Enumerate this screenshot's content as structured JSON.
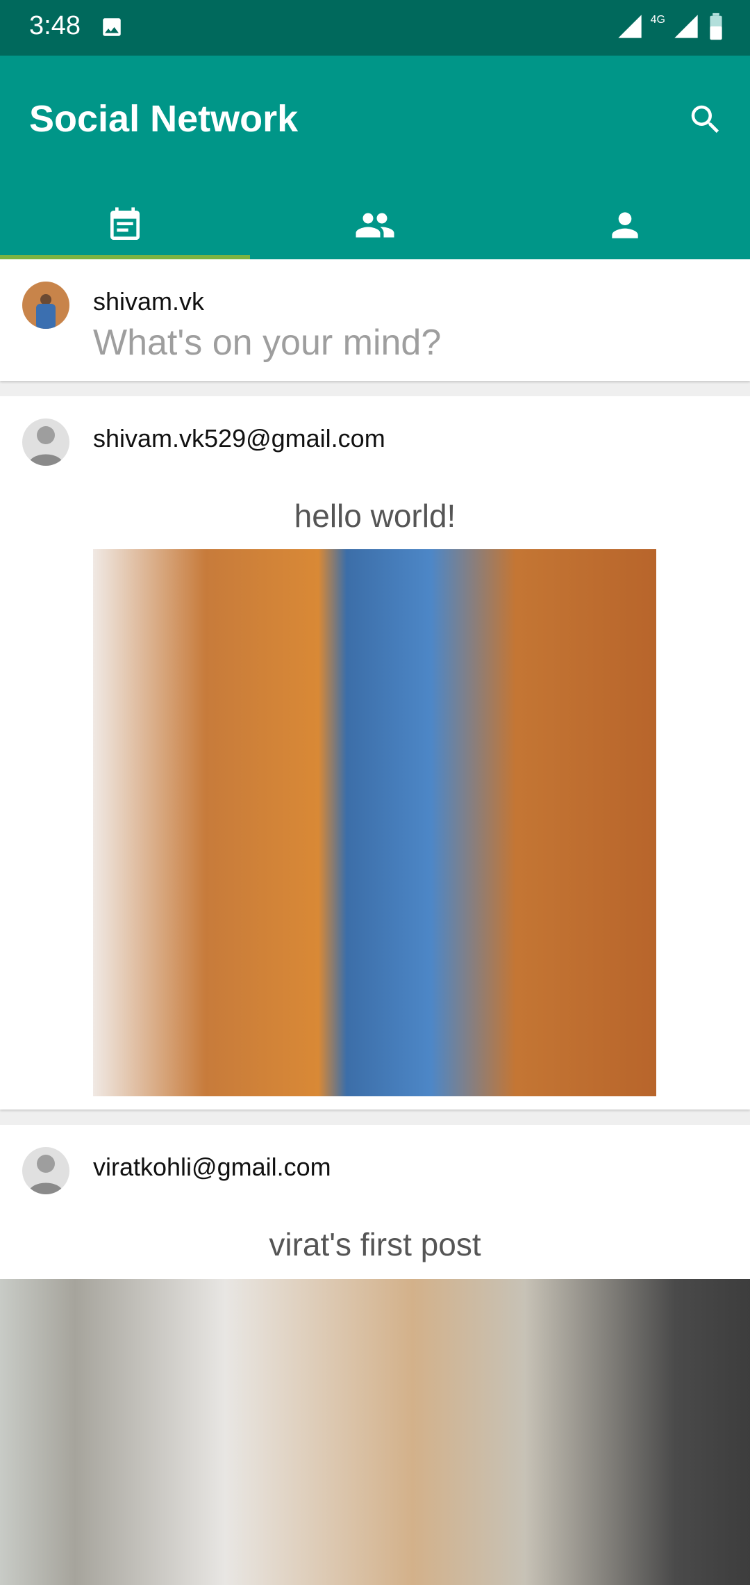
{
  "status_bar": {
    "time": "3:48",
    "network": "4G"
  },
  "app_bar": {
    "title": "Social Network",
    "color": "#009688",
    "tabs": [
      {
        "icon": "feed-icon",
        "active": true
      },
      {
        "icon": "people-icon",
        "active": false
      },
      {
        "icon": "person-icon",
        "active": false
      }
    ]
  },
  "composer": {
    "username": "shivam.vk",
    "placeholder": "What's on your mind?"
  },
  "posts": [
    {
      "author": "shivam.vk529@gmail.com",
      "caption": "hello world!"
    },
    {
      "author": "viratkohli@gmail.com",
      "caption": "virat's first post"
    }
  ]
}
